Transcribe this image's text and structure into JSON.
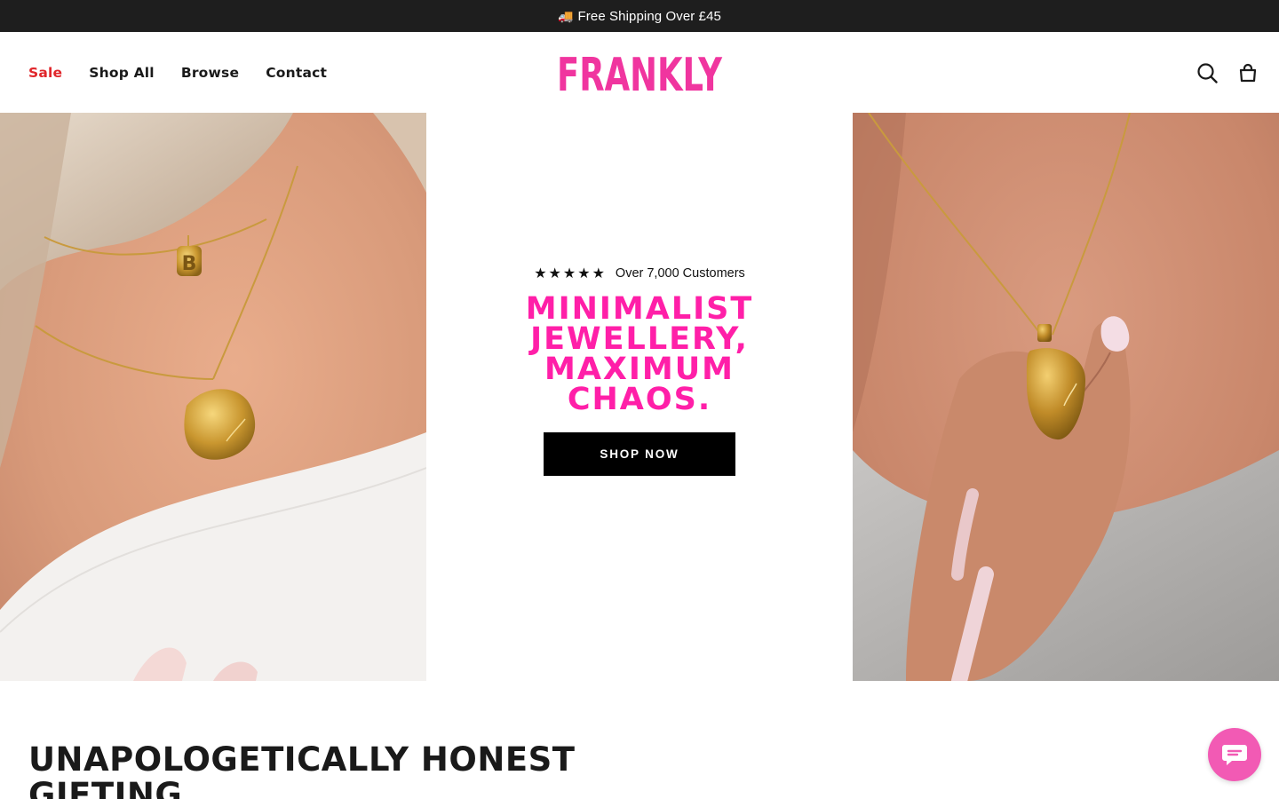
{
  "announcement": {
    "icon": "truck-icon",
    "text": "Free Shipping Over £45"
  },
  "nav": {
    "items": [
      {
        "label": "Sale",
        "color": "#e0262b"
      },
      {
        "label": "Shop All"
      },
      {
        "label": "Browse"
      },
      {
        "label": "Contact"
      }
    ]
  },
  "logo": {
    "text": "FRANKLY",
    "color": "#f0359f"
  },
  "header_icons": [
    "search-icon",
    "bag-icon"
  ],
  "hero": {
    "stars": "★★★★★",
    "rating_text": "Over 7,000 Customers",
    "title": "MINIMALIST JEWELLERY, MAXIMUM CHAOS.",
    "title_color": "#ff1fa8",
    "cta_label": "SHOP NOW"
  },
  "section": {
    "title": "UNAPOLOGETICALLY HONEST GIFTING"
  },
  "chat": {
    "icon": "chat-icon",
    "color": "#f25ab4"
  }
}
